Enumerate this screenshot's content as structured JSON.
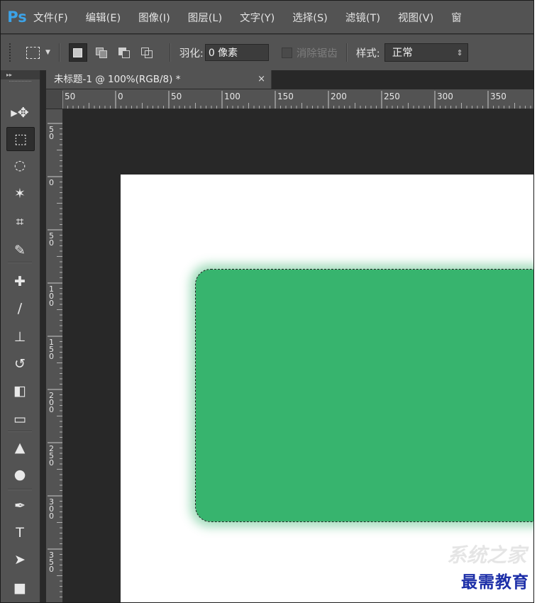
{
  "app": {
    "logo": "Ps",
    "menu": [
      "文件(F)",
      "编辑(E)",
      "图像(I)",
      "图层(L)",
      "文字(Y)",
      "选择(S)",
      "滤镜(T)",
      "视图(V)",
      "窗"
    ]
  },
  "options": {
    "feather_label": "羽化:",
    "feather_value": "0 像素",
    "antialias_label": "消除锯齿",
    "style_label": "样式:",
    "style_value": "正常",
    "style_arrows": "⇕"
  },
  "toolbar": {
    "collapse": "▸▸",
    "tools": [
      {
        "name": "move-tool",
        "glyph": "▸✥"
      },
      {
        "name": "marquee-tool",
        "glyph": "⬚"
      },
      {
        "name": "lasso-tool",
        "glyph": "◌"
      },
      {
        "name": "magic-wand-tool",
        "glyph": "✶"
      },
      {
        "name": "crop-tool",
        "glyph": "⌗"
      },
      {
        "name": "eyedropper-tool",
        "glyph": "✎"
      },
      {
        "name": "healing-brush-tool",
        "glyph": "✚"
      },
      {
        "name": "brush-tool",
        "glyph": "∕"
      },
      {
        "name": "clone-stamp-tool",
        "glyph": "⊥"
      },
      {
        "name": "history-brush-tool",
        "glyph": "↺"
      },
      {
        "name": "eraser-tool",
        "glyph": "◧"
      },
      {
        "name": "gradient-tool",
        "glyph": "▭"
      },
      {
        "name": "blur-tool",
        "glyph": "▲"
      },
      {
        "name": "dodge-tool",
        "glyph": "●"
      },
      {
        "name": "pen-tool",
        "glyph": "✒"
      },
      {
        "name": "type-tool",
        "glyph": "T"
      },
      {
        "name": "path-selection-tool",
        "glyph": "➤"
      },
      {
        "name": "rectangle-tool",
        "glyph": "■"
      }
    ]
  },
  "document": {
    "tab_title": "未标题-1 @ 100%(RGB/8) *",
    "close": "×",
    "ruler_top": [
      "50",
      "0",
      "50",
      "100",
      "150",
      "200",
      "250",
      "300",
      "350"
    ],
    "ruler_left": [
      "50",
      "0",
      "50",
      "100",
      "150",
      "200",
      "250",
      "300",
      "350"
    ]
  },
  "watermark": {
    "site": "系统之家",
    "brand": "最需教育"
  },
  "colors": {
    "shape_fill": "#37b46e",
    "ui_dark": "#282828",
    "ui_panel": "#535353",
    "watermark": "#1d2fa8"
  }
}
